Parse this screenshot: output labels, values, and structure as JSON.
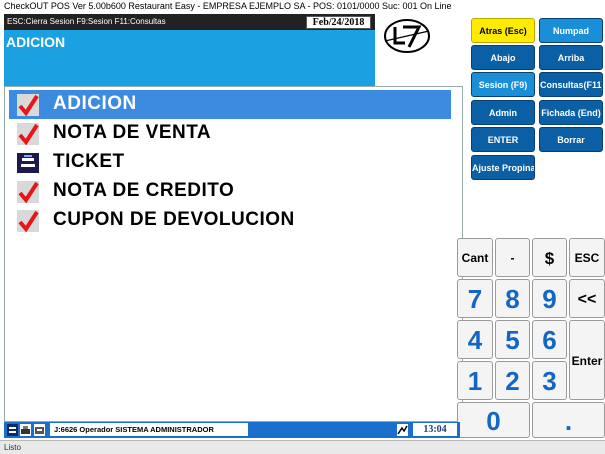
{
  "window": {
    "title": "CheckOUT POS Ver 5.00b600 Restaurant Easy - EMPRESA EJEMPLO SA - POS: 0101/0000 Suc: 001  On Line"
  },
  "header": {
    "shortcuts": "ESC:Cierra Sesion F9:Sesion F11:Consultas",
    "date": "Feb/24/2018",
    "module": "ADICION"
  },
  "function_buttons": [
    {
      "label": "Atras (Esc)"
    },
    {
      "label": "Numpad"
    },
    {
      "label": "Abajo"
    },
    {
      "label": "Arriba"
    },
    {
      "label": "Sesion (F9)"
    },
    {
      "label": "Consultas(F11)"
    },
    {
      "label": "Admin"
    },
    {
      "label": "Fichada (End)"
    },
    {
      "label": "ENTER"
    },
    {
      "label": "Borrar"
    },
    {
      "label": "Ajuste Propina"
    }
  ],
  "menu": {
    "items": [
      {
        "label": "ADICION",
        "icon": "checkmark-icon",
        "selected": true
      },
      {
        "label": "NOTA DE VENTA",
        "icon": "checkmark-icon"
      },
      {
        "label": "TICKET",
        "icon": "ticket-icon"
      },
      {
        "label": "NOTA DE CREDITO",
        "icon": "checkmark-icon"
      },
      {
        "label": "CUPON DE DEVOLUCION",
        "icon": "checkmark-icon"
      }
    ]
  },
  "keypad": {
    "cant": "Cant",
    "minus": "-",
    "dollar": "$",
    "esc": "ESC",
    "backspace": "<<",
    "enter": "Enter",
    "digits": [
      "7",
      "8",
      "9",
      "4",
      "5",
      "6",
      "1",
      "2",
      "3",
      "0"
    ],
    "dot": "."
  },
  "status": {
    "operator": "J:6626 Operador  SISTEMA ADMINISTRADOR",
    "time": "13:04",
    "bottom": "Listo"
  },
  "colors": {
    "header_blue": "#1ba1e2",
    "button_blue": "#0b5fa5",
    "button_yellow": "#ffeb00",
    "selection_blue": "#3c8be0",
    "check_red": "#e8141a",
    "digit_blue": "#1366c5"
  }
}
